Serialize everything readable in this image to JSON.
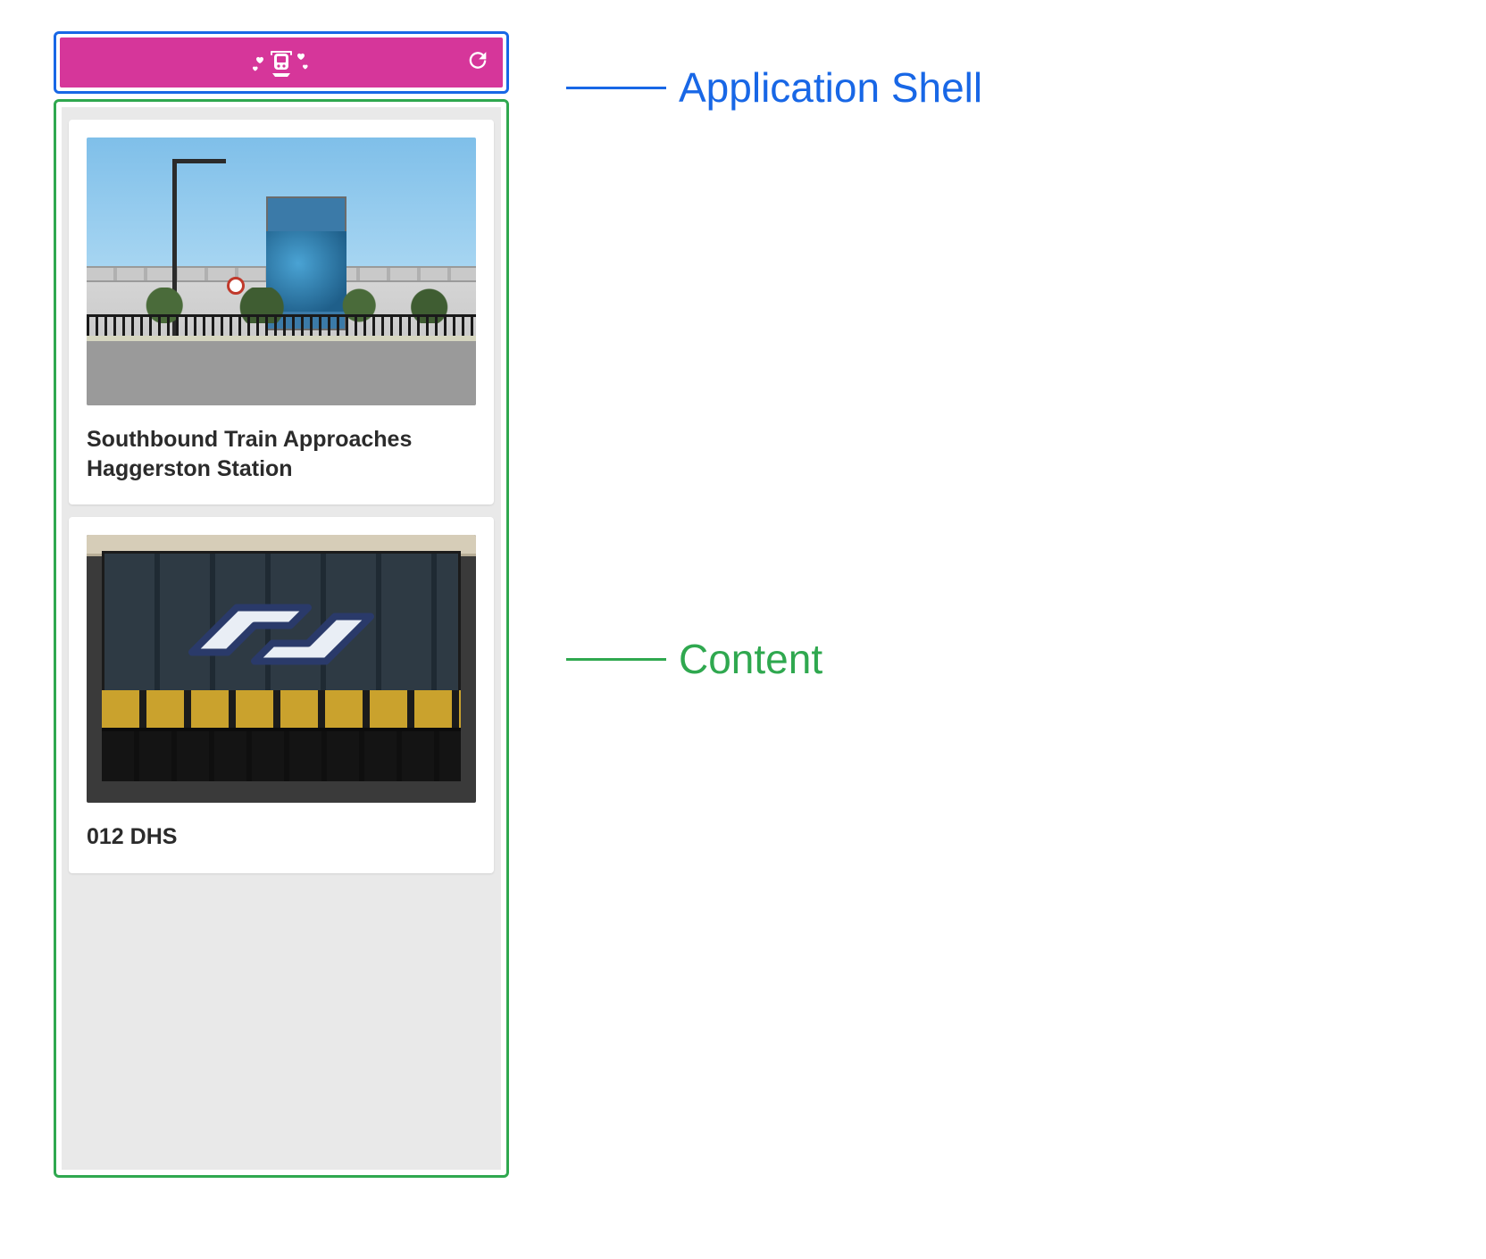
{
  "annotations": {
    "shell": "Application Shell",
    "content": "Content"
  },
  "header": {
    "logo_name": "train-hearts-logo",
    "refresh_name": "refresh-icon"
  },
  "cards": [
    {
      "title": "Southbound Train Approaches Haggerston Station"
    },
    {
      "title": "012 DHS"
    }
  ],
  "colors": {
    "shell_outline": "#1867e6",
    "content_outline": "#2fa84f",
    "app_bar": "#d6369a"
  }
}
